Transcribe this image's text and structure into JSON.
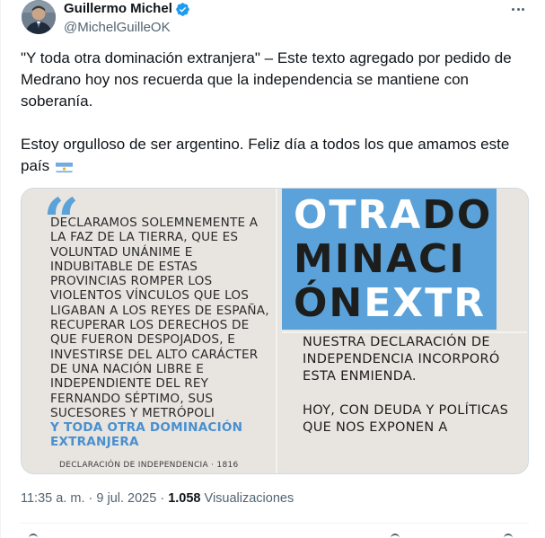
{
  "author": {
    "display_name": "Guillermo Michel",
    "handle": "@MichelGuilleOK"
  },
  "tweet": {
    "paragraph_1": "\"Y toda otra dominación extranjera\" – Este texto agregado por pedido de Medrano hoy nos recuerda que la independencia se mantiene con soberanía.",
    "paragraph_2": "Estoy orgulloso de ser argentino. Feliz día a todos los que amamos este país"
  },
  "media": {
    "left": {
      "quote_mark": "“",
      "body": "Declaramos solemnemente a la faz de la tierra, que es voluntad unánime e indubitable de estas provincias romper los violentos vínculos que los ligaban a los reyes de España, recuperar los derechos de que fueron despojados, e investirse del alto carácter de una nación libre e independiente del rey Fernando Séptimo, sus sucesores y metrópoli",
      "highlight": "y toda otra dominación extranjera",
      "caption": "DECLARACIÓN DE INDEPENDENCIA · 1816"
    },
    "right": {
      "line1_white": "OTRA",
      "line1_dark": "DO",
      "line2_dark": "MINACI",
      "line3_dark": "ÓN",
      "line3_white": "EXTR",
      "paragraph_1": "Nuestra declaración de independencia incorporó esta enmienda.",
      "paragraph_2": "Hoy, con deuda y políticas que nos exponen a"
    }
  },
  "meta": {
    "time": "11:35 a. m.",
    "separator": "·",
    "date": "9 jul. 2025",
    "views_count": "1.058",
    "views_label": "Visualizaciones"
  },
  "colors": {
    "verified_blue": "#1d9bf0",
    "flag_blue": "#74acdf",
    "panel_blue": "#5aa2d9",
    "secondary_text": "#536471"
  },
  "icons": {
    "verified": "verified-badge-icon",
    "more": "more-options-icon",
    "flag": "argentina-flag-icon"
  }
}
